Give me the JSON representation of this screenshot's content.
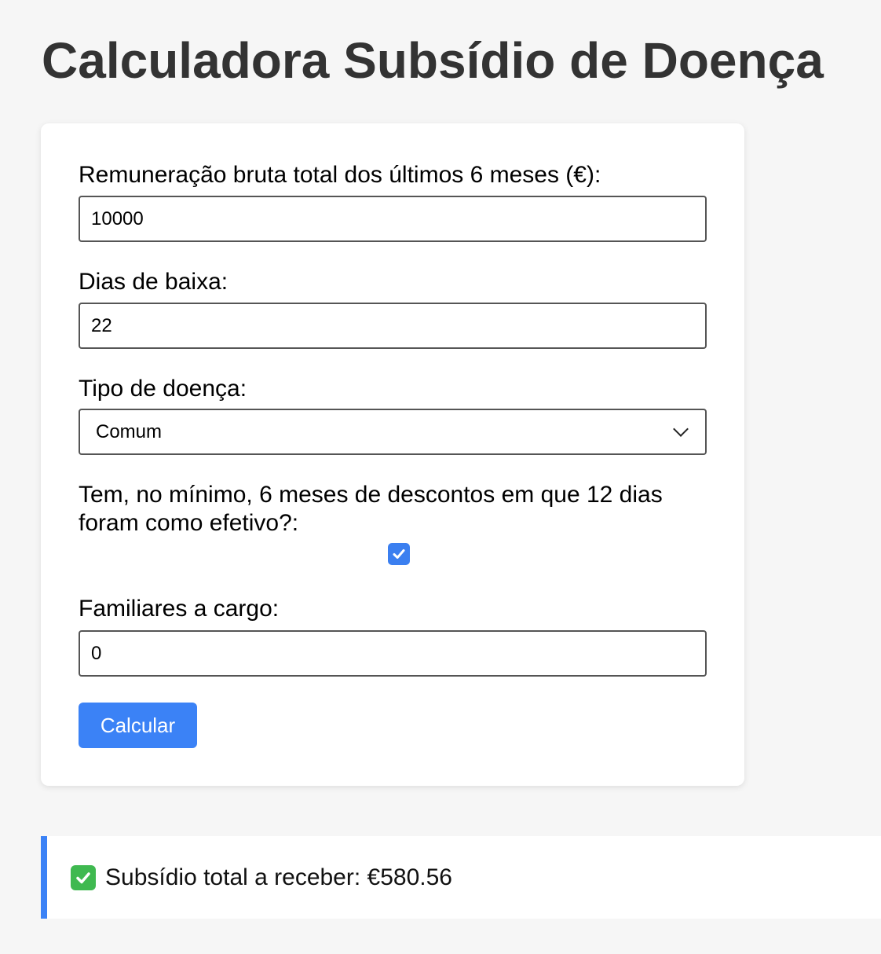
{
  "page": {
    "title": "Calculadora Subsídio de Doença"
  },
  "form": {
    "remuneracao": {
      "label": "Remuneração bruta total dos últimos 6 meses (€):",
      "value": "10000"
    },
    "dias": {
      "label": "Dias de baixa:",
      "value": "22"
    },
    "tipo": {
      "label": "Tipo de doença:",
      "selected": "Comum"
    },
    "descontos": {
      "label_line1": "Tem, no mínimo, 6 meses de descontos em que 12 dias",
      "label_line2": "foram como efetivo?:",
      "checked": true
    },
    "familiares": {
      "label": "Familiares a cargo:",
      "value": "0"
    },
    "button_label": "Calcular"
  },
  "result": {
    "text": "Subsídio total a receber: €580.56"
  },
  "colors": {
    "accent": "#3b82f6",
    "background": "#f6f6f6",
    "title": "#333333"
  }
}
